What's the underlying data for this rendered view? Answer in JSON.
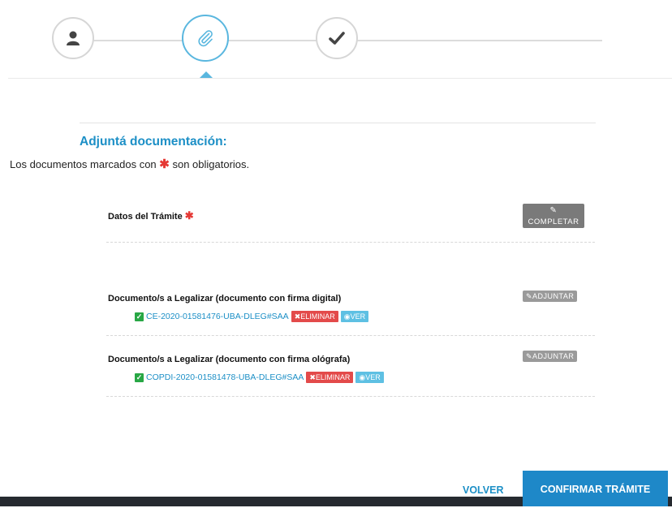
{
  "stepper": {
    "steps": [
      {
        "icon": "user-icon",
        "state": "done"
      },
      {
        "icon": "paperclip-icon",
        "state": "active"
      },
      {
        "icon": "checkmark-icon",
        "state": "pending"
      }
    ],
    "active_color": "#5ab7df"
  },
  "main": {
    "title": "Adjuntá documentación:",
    "subtitle_prefix": "Los documentos marcados con",
    "subtitle_suffix": "son obligatorios.",
    "required_mark": "✱"
  },
  "documents": [
    {
      "title": "Datos del Trámite",
      "required": "✱",
      "action_label": "COMPLETAR"
    },
    {
      "title": "Documento/s a Legalizar (documento con firma digital)",
      "action_label": "ADJUNTAR",
      "file": {
        "name": "CE-2020-01581476-UBA-DLEG#SAA",
        "delete_label": "ELIMINAR",
        "view_label": "VER"
      }
    },
    {
      "title": "Documento/s a Legalizar (documento con firma ológrafa)",
      "action_label": "ADJUNTAR",
      "file": {
        "name": "COPDI-2020-01581478-UBA-DLEG#SAA",
        "delete_label": "ELIMINAR",
        "view_label": "VER"
      }
    }
  ],
  "footer": {
    "back_label": "VOLVER",
    "confirm_label": "CONFIRMAR TRÁMITE"
  },
  "colors": {
    "accent": "#1c8fc6",
    "required": "#e53935",
    "delete": "#e34a4a",
    "view": "#5ec0e3",
    "success": "#28a745"
  }
}
